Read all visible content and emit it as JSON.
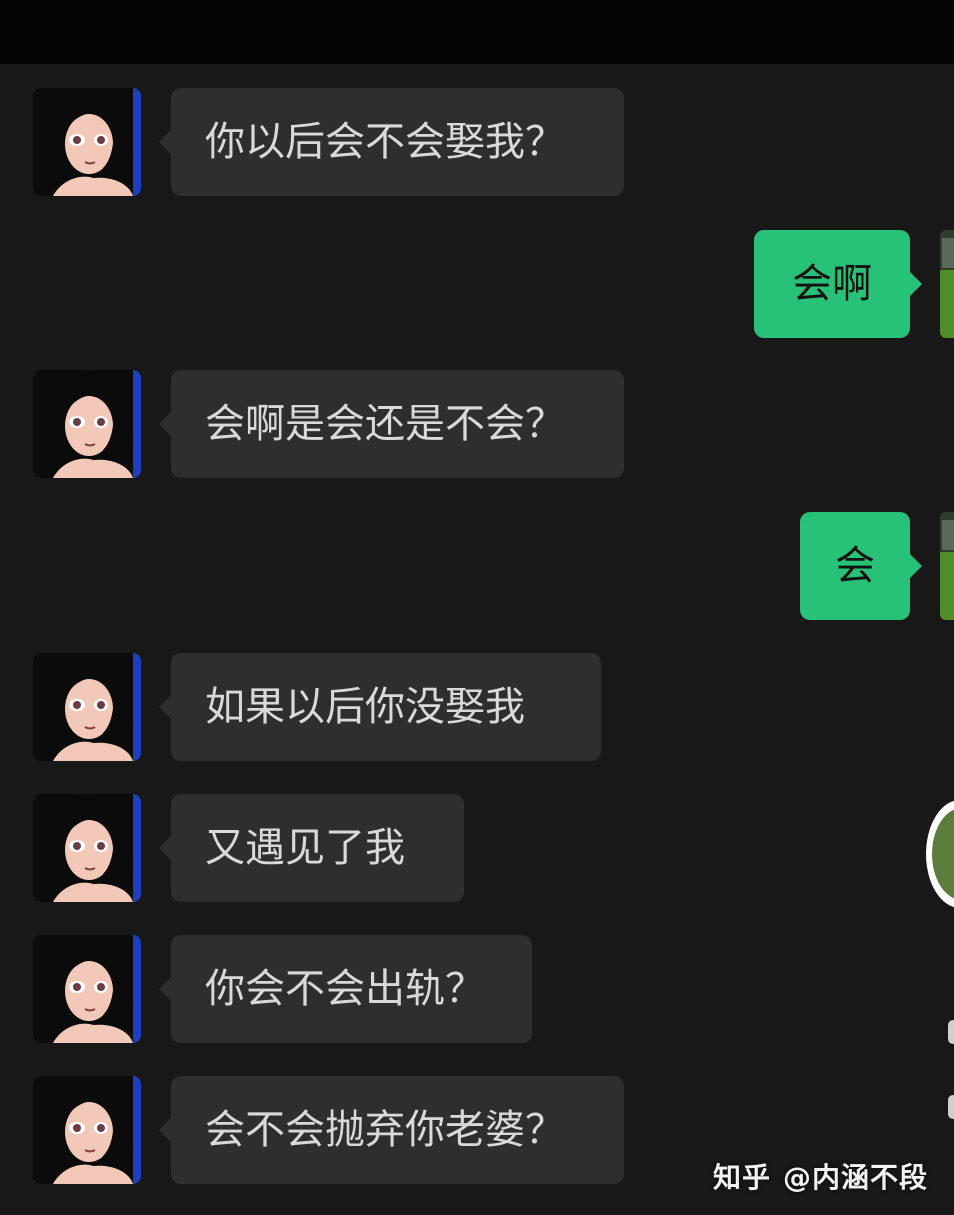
{
  "messages": [
    {
      "side": "left",
      "text": "你以后会不会娶我？"
    },
    {
      "side": "right",
      "text": "会啊"
    },
    {
      "side": "left",
      "text": "会啊是会还是不会？"
    },
    {
      "side": "right",
      "text": "会"
    },
    {
      "side": "left",
      "text": "如果以后你没娶我"
    },
    {
      "side": "left",
      "text": "又遇见了我"
    },
    {
      "side": "left",
      "text": "你会不会出轨？"
    },
    {
      "side": "left",
      "text": "会不会抛弃你老婆？"
    }
  ],
  "watermark": {
    "brand": "知乎",
    "author": "@内涵不段"
  },
  "colors": {
    "background": "#181818",
    "incoming_bubble": "#2e2e2e",
    "outgoing_bubble": "#27c177"
  }
}
